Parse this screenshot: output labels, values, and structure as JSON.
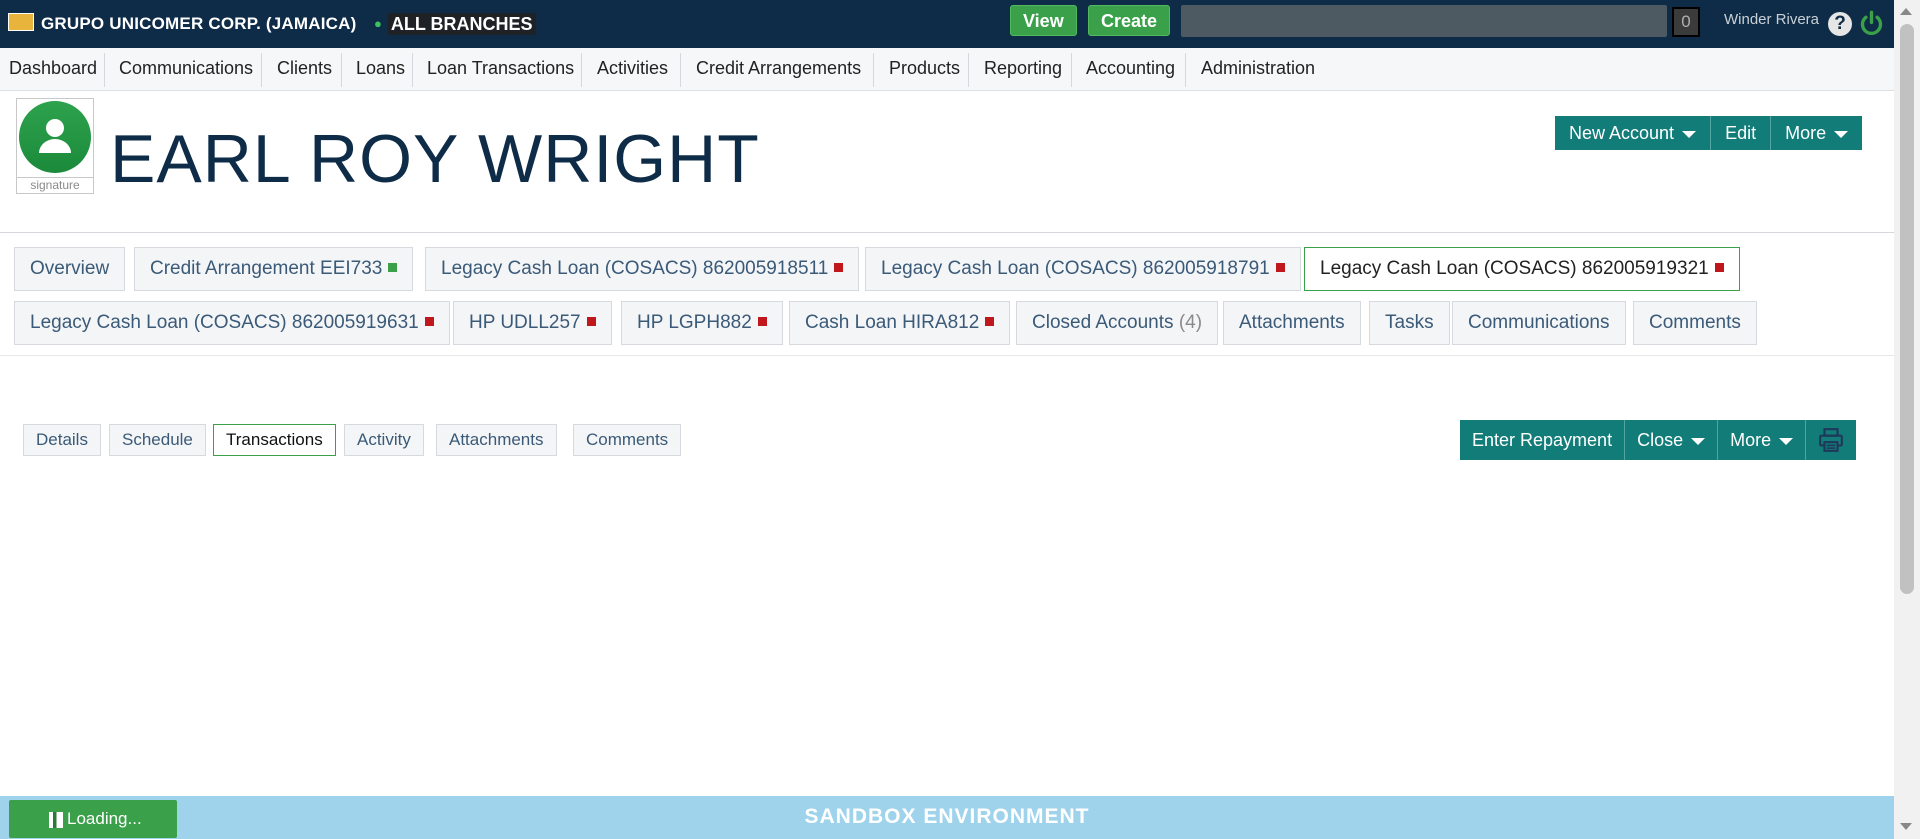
{
  "topbar": {
    "company": "GRUPO UNICOMER CORP. (JAMAICA)",
    "branch": "ALL BRANCHES",
    "view_label": "View",
    "create_label": "Create",
    "search_value": "",
    "notification_count": "0",
    "user_name": "Winder Rivera",
    "help_label": "?"
  },
  "nav": {
    "items": [
      "Dashboard",
      "Communications",
      "Clients",
      "Loans",
      "Loan Transactions",
      "Activities",
      "Credit Arrangements",
      "Products",
      "Reporting",
      "Accounting",
      "Administration"
    ]
  },
  "client": {
    "name": "EARL ROY WRIGHT",
    "avatar_caption": "signature"
  },
  "client_actions": {
    "new_account": "New Account",
    "edit": "Edit",
    "more": "More"
  },
  "account_tabs": [
    {
      "label": "Overview"
    },
    {
      "label": "Credit Arrangement EEI733",
      "status": "green"
    },
    {
      "label": "Legacy Cash Loan (COSACS) 862005918511",
      "status": "red"
    },
    {
      "label": "Legacy Cash Loan (COSACS) 862005918791",
      "status": "red"
    },
    {
      "label": "Legacy Cash Loan (COSACS) 862005919321",
      "status": "red",
      "active": true
    },
    {
      "label": "Legacy Cash Loan (COSACS) 862005919631",
      "status": "red"
    },
    {
      "label": "HP UDLL257",
      "status": "red"
    },
    {
      "label": "HP LGPH882",
      "status": "red"
    },
    {
      "label": "Cash Loan HIRA812",
      "status": "red"
    },
    {
      "label": "Closed Accounts",
      "count": "(4)"
    },
    {
      "label": "Attachments"
    },
    {
      "label": "Tasks"
    },
    {
      "label": "Communications"
    },
    {
      "label": "Comments"
    }
  ],
  "loan_tabs": [
    {
      "label": "Details"
    },
    {
      "label": "Schedule"
    },
    {
      "label": "Transactions",
      "active": true
    },
    {
      "label": "Activity"
    },
    {
      "label": "Attachments"
    },
    {
      "label": "Comments"
    }
  ],
  "loan_actions": {
    "enter_repayment": "Enter Repayment",
    "close": "Close",
    "more": "More",
    "print_icon": "printer-icon"
  },
  "footer": {
    "environment": "SANDBOX ENVIRONMENT",
    "loading": "Loading..."
  },
  "colors": {
    "topbar": "#0e2c47",
    "green": "#3aa04a",
    "teal": "#127c78",
    "status_red": "#c0171d",
    "status_green": "#3aa04a",
    "footer": "#9fd3ec"
  }
}
